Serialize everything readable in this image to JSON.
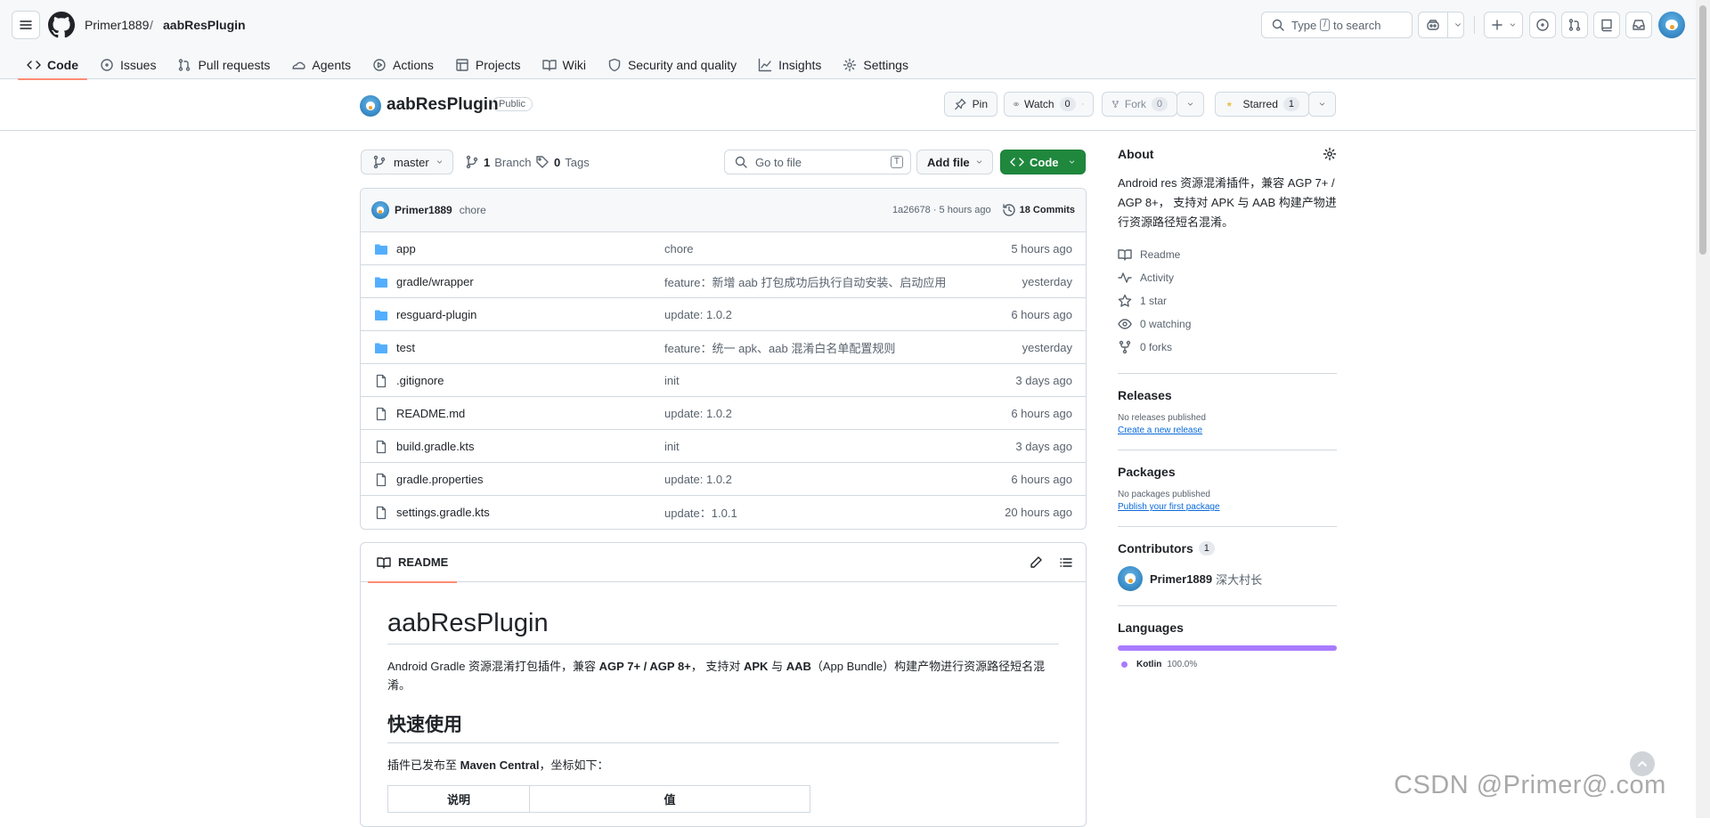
{
  "header": {
    "owner": "Primer1889",
    "separator": "/",
    "repo": "aabResPlugin",
    "search_prefix": "Type",
    "search_key": "/",
    "search_suffix": "to search"
  },
  "tabs": [
    {
      "label": "Code",
      "icon": "code-icon"
    },
    {
      "label": "Issues",
      "icon": "issue-icon"
    },
    {
      "label": "Pull requests",
      "icon": "pull-request-icon"
    },
    {
      "label": "Agents",
      "icon": "agents-icon"
    },
    {
      "label": "Actions",
      "icon": "play-icon"
    },
    {
      "label": "Projects",
      "icon": "table-icon"
    },
    {
      "label": "Wiki",
      "icon": "book-icon"
    },
    {
      "label": "Security and quality",
      "icon": "shield-icon"
    },
    {
      "label": "Insights",
      "icon": "graph-icon"
    },
    {
      "label": "Settings",
      "icon": "gear-icon"
    }
  ],
  "repohead": {
    "name": "aabResPlugin",
    "visibility": "Public",
    "pin": "Pin",
    "watch": "Watch",
    "watch_count": "0",
    "fork": "Fork",
    "fork_count": "0",
    "starred": "Starred",
    "star_count": "1"
  },
  "toolbar": {
    "branch": "master",
    "branch_count": "1",
    "branch_label": "Branch",
    "tag_count": "0",
    "tag_label": "Tags",
    "goto_placeholder": "Go to file",
    "goto_key": "T",
    "add_file": "Add file",
    "code": "Code"
  },
  "commit": {
    "author": "Primer1889",
    "message": "chore",
    "sha_time": "1a26678 · 5 hours ago",
    "commits": "18 Commits"
  },
  "files": [
    {
      "name": "app",
      "type": "dir",
      "message": "chore",
      "time": "5 hours ago"
    },
    {
      "name": "gradle/wrapper",
      "type": "dir",
      "message": "feature：新增 aab 打包成功后执行自动安装、启动应用",
      "time": "yesterday"
    },
    {
      "name": "resguard-plugin",
      "type": "dir",
      "message": "update: 1.0.2",
      "time": "6 hours ago"
    },
    {
      "name": "test",
      "type": "dir",
      "message": "feature：统一 apk、aab 混淆白名单配置规则",
      "time": "yesterday"
    },
    {
      "name": ".gitignore",
      "type": "file",
      "message": "init",
      "time": "3 days ago"
    },
    {
      "name": "README.md",
      "type": "file",
      "message": "update: 1.0.2",
      "time": "6 hours ago"
    },
    {
      "name": "build.gradle.kts",
      "type": "file",
      "message": "init",
      "time": "3 days ago"
    },
    {
      "name": "gradle.properties",
      "type": "file",
      "message": "update: 1.0.2",
      "time": "6 hours ago"
    },
    {
      "name": "settings.gradle.kts",
      "type": "file",
      "message": "update：1.0.1",
      "time": "20 hours ago"
    }
  ],
  "readme": {
    "tab": "README",
    "h1": "aabResPlugin",
    "p1_a": "Android Gradle 资源混淆打包插件，兼容 ",
    "p1_b": "AGP 7+ / AGP 8+",
    "p1_c": "， 支持对 ",
    "p1_d": "APK",
    "p1_e": " 与 ",
    "p1_f": "AAB",
    "p1_g": "（App Bundle）构建产物进行资源路径短名混淆。",
    "h2": "快速使用",
    "p2_a": "插件已发布至 ",
    "p2_b": "Maven Central",
    "p2_c": "，坐标如下：",
    "th1": "说明",
    "th2": "值"
  },
  "about": {
    "title": "About",
    "desc": "Android res 资源混淆插件，兼容 AGP 7+ / AGP 8+， 支持对 APK 与 AAB 构建产物进行资源路径短名混淆。",
    "items": [
      {
        "label": "Readme",
        "icon": "book-icon"
      },
      {
        "label": "Activity",
        "icon": "pulse-icon"
      },
      {
        "label": "1 star",
        "icon": "star-icon"
      },
      {
        "label": "0 watching",
        "icon": "eye-icon"
      },
      {
        "label": "0 forks",
        "icon": "fork-icon"
      }
    ]
  },
  "releases": {
    "title": "Releases",
    "empty": "No releases published",
    "link": "Create a new release"
  },
  "packages": {
    "title": "Packages",
    "empty": "No packages published",
    "link": "Publish your first package"
  },
  "contributors": {
    "title": "Contributors",
    "count": "1",
    "user": "Primer1889",
    "nickname": "深大村长"
  },
  "languages": {
    "title": "Languages",
    "items": [
      {
        "name": "Kotlin",
        "percent": "100.0%",
        "value": 100,
        "color": "#A97BFF"
      }
    ]
  },
  "watermark": "CSDN @Primer@.com"
}
